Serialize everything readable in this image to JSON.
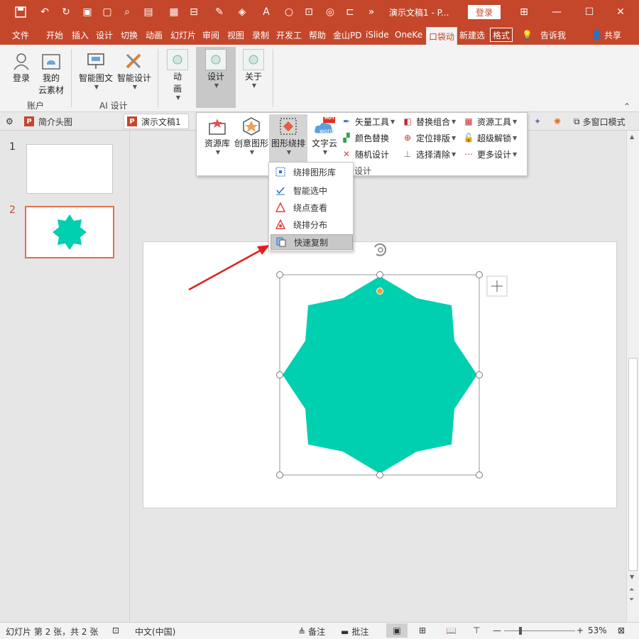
{
  "window": {
    "title": "演示文稿1 - P...",
    "login_button": "登录",
    "controls": [
      "ribbon-display",
      "minimize",
      "maximize",
      "close"
    ]
  },
  "tabs": [
    {
      "label": "文件"
    },
    {
      "label": "开始"
    },
    {
      "label": "插入"
    },
    {
      "label": "设计"
    },
    {
      "label": "切换"
    },
    {
      "label": "动画"
    },
    {
      "label": "幻灯片"
    },
    {
      "label": "审阅"
    },
    {
      "label": "视图"
    },
    {
      "label": "录制"
    },
    {
      "label": "开发工"
    },
    {
      "label": "帮助"
    },
    {
      "label": "金山PD"
    },
    {
      "label": "iSlide"
    },
    {
      "label": "OneKe"
    },
    {
      "label": "口袋动"
    },
    {
      "label": "新建选"
    },
    {
      "label": "格式"
    },
    {
      "label": "告诉我"
    },
    {
      "label": "共享"
    }
  ],
  "ribbon": {
    "account_group": {
      "label": "账户",
      "login": "登录",
      "cloud": "我的\n云素材"
    },
    "ai_group": {
      "label": "AI 设计",
      "smart_text": "智能图文",
      "smart_design": "智能设计"
    },
    "anim": "动\n画",
    "design": "设计",
    "about": "关于"
  },
  "doc_tabs": [
    {
      "label": "简介头图"
    },
    {
      "label": "演示文稿1"
    }
  ],
  "doc_right": {
    "multiwindow": "多窗口模式"
  },
  "design_dropdown": {
    "big_buttons": [
      {
        "label": "资源库"
      },
      {
        "label": "创意图形"
      },
      {
        "label": "图形绕排"
      },
      {
        "label": "文字云"
      }
    ],
    "hot_badge": "HOT",
    "word_badge": "word",
    "col1": [
      "矢量工具",
      "颜色替换",
      "随机设计"
    ],
    "col2": [
      "替换组合",
      "定位排版",
      "选择清除"
    ],
    "col3": [
      "资源工具",
      "超级解锁",
      "更多设计"
    ],
    "group_label": "设计"
  },
  "wrap_menu": {
    "items": [
      {
        "label": "绕排图形库"
      },
      {
        "label": "智能选中"
      },
      {
        "label": "绕点查看"
      },
      {
        "label": "绕排分布"
      },
      {
        "label": "快速复制"
      }
    ]
  },
  "slides": [
    {
      "number": "1"
    },
    {
      "number": "2"
    }
  ],
  "shape": {
    "color": "#00cfb0"
  },
  "status": {
    "slide_info": "幻灯片 第 2 张，共 2 张",
    "language": "中文(中国)",
    "notes": "备注",
    "comments": "批注",
    "zoom": "53%"
  },
  "colors": {
    "brand": "#c4472b",
    "shape": "#00cfb0",
    "arrow": "#e02020"
  }
}
